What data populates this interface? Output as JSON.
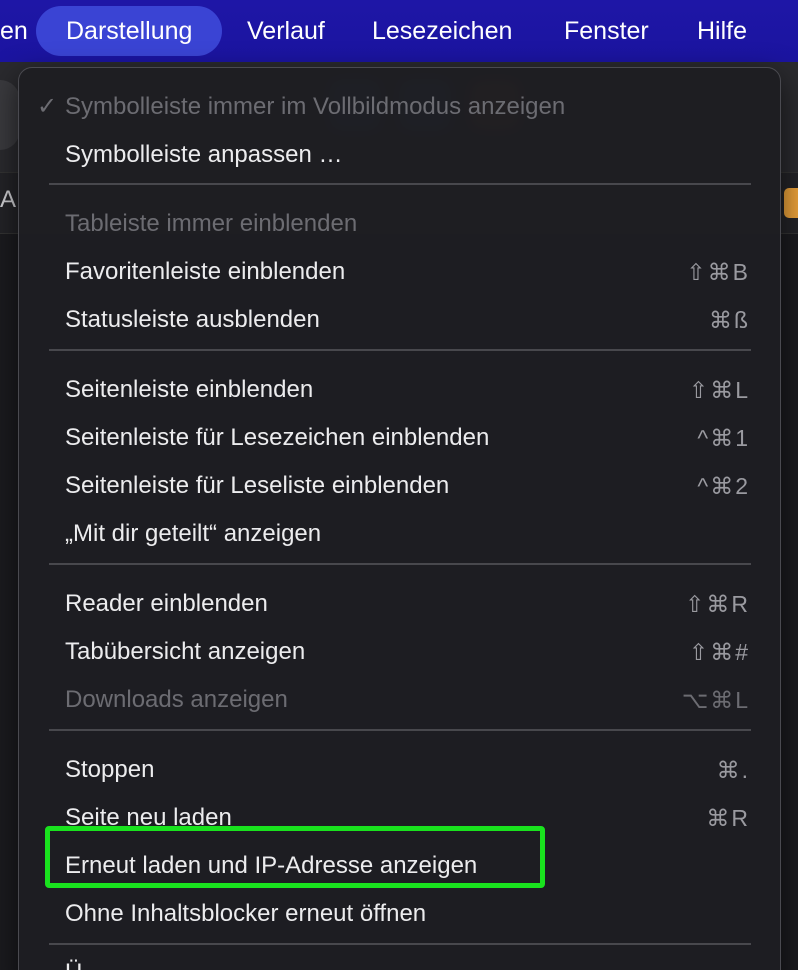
{
  "menubar": {
    "items": [
      {
        "label": "en"
      },
      {
        "label": "Darstellung"
      },
      {
        "label": "Verlauf"
      },
      {
        "label": "Lesezeichen"
      },
      {
        "label": "Fenster"
      },
      {
        "label": "Hilfe"
      }
    ]
  },
  "background": {
    "left_text": "A",
    "badge_color": "#e8a03a"
  },
  "menu": {
    "items": [
      {
        "check": "✓",
        "label": "Symbolleiste immer im Vollbildmodus anzeigen",
        "shortcut": "",
        "disabled": true
      },
      {
        "check": "",
        "label": "Symbolleiste anpassen …",
        "shortcut": "",
        "disabled": false
      },
      {
        "check": "",
        "label": "Tableiste immer einblenden",
        "shortcut": "",
        "disabled": true
      },
      {
        "check": "",
        "label": "Favoritenleiste einblenden",
        "shortcut": "⇧⌘B",
        "disabled": false
      },
      {
        "check": "",
        "label": "Statusleiste ausblenden",
        "shortcut": "⌘ß",
        "disabled": false
      },
      {
        "check": "",
        "label": "Seitenleiste einblenden",
        "shortcut": "⇧⌘L",
        "disabled": false
      },
      {
        "check": "",
        "label": "Seitenleiste für Lesezeichen einblenden",
        "shortcut": "^⌘1",
        "disabled": false
      },
      {
        "check": "",
        "label": "Seitenleiste für Leseliste einblenden",
        "shortcut": "^⌘2",
        "disabled": false
      },
      {
        "check": "",
        "label": "„Mit dir geteilt“ anzeigen",
        "shortcut": "",
        "disabled": false
      },
      {
        "check": "",
        "label": "Reader einblenden",
        "shortcut": "⇧⌘R",
        "disabled": false
      },
      {
        "check": "",
        "label": "Tabübersicht anzeigen",
        "shortcut": "⇧⌘#",
        "disabled": false
      },
      {
        "check": "",
        "label": "Downloads anzeigen",
        "shortcut": "⌥⌘L",
        "disabled": true
      },
      {
        "check": "",
        "label": "Stoppen",
        "shortcut": "⌘.",
        "disabled": false
      },
      {
        "check": "",
        "label": "Seite neu laden",
        "shortcut": "⌘R",
        "disabled": false
      },
      {
        "check": "",
        "label": "Erneut laden und IP-Adresse anzeigen",
        "shortcut": "",
        "disabled": false
      },
      {
        "check": "",
        "label": "Ohne Inhaltsblocker erneut öffnen",
        "shortcut": "",
        "disabled": false
      },
      {
        "check": "",
        "label": "Ü",
        "shortcut": "",
        "disabled": false
      }
    ]
  },
  "highlight_color": "#19e21e"
}
